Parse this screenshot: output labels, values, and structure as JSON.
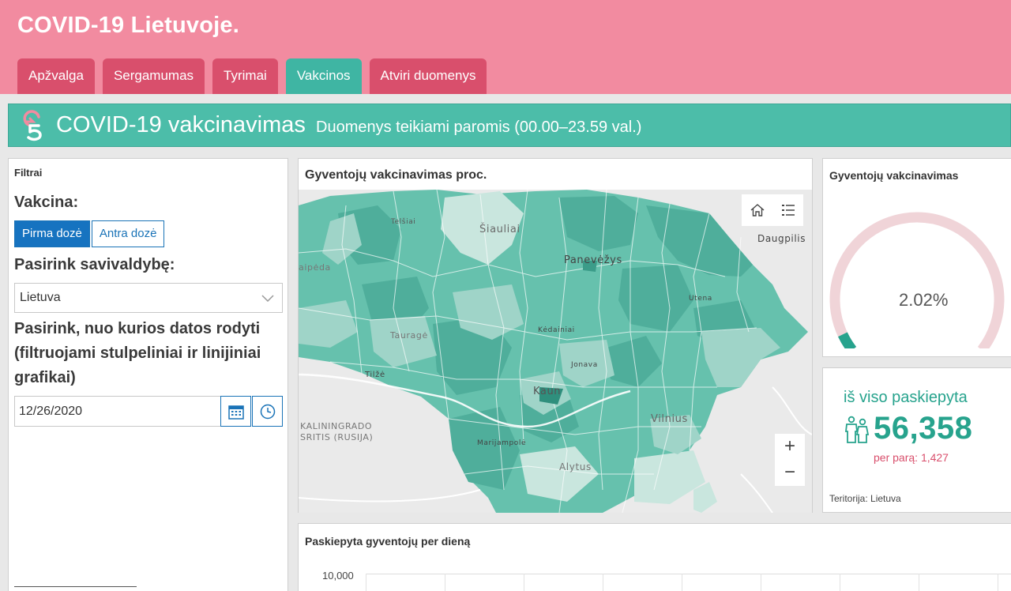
{
  "header": {
    "title": "COVID-19 Lietuvoje.",
    "tabs": [
      {
        "label": "Apžvalga"
      },
      {
        "label": "Sergamumas"
      },
      {
        "label": "Tyrimai"
      },
      {
        "label": "Vakcinos",
        "active": true
      },
      {
        "label": "Atviri duomenys"
      }
    ]
  },
  "banner": {
    "title": "COVID-19 vakcinavimas",
    "subtitle": "Duomenys teikiami paromis (00.00–23.59 val.)",
    "logo_icon": "covid-logo-icon"
  },
  "filters": {
    "panel_title": "Filtrai",
    "vaccine_heading": "Vakcina:",
    "dose_buttons": [
      {
        "label": "Pirma dozė",
        "selected": true
      },
      {
        "label": "Antra dozė",
        "selected": false
      }
    ],
    "municipality_heading": "Pasirink savivaldybę:",
    "municipality_value": "Lietuva",
    "date_heading": "Pasirink, nuo kurios datos rodyti (filtruojami stulpeliniai ir linijiniai grafikai)",
    "date_value": "12/26/2020",
    "calendar_icon": "calendar-icon",
    "clock_icon": "clock-icon"
  },
  "map": {
    "title": "Gyventojų vakcinavimas proc.",
    "labels": {
      "siauliai": "Šiauliai",
      "telsiai": "Telšiai",
      "klaipeda": "aipėda",
      "panevezys": "Panevėžys",
      "utena": "Utena",
      "daugpilis": "Daugpilis",
      "taurage": "Tauragė",
      "kedainiai": "Kėdainiai",
      "jonava": "Jonava",
      "tilze": "Tilžė",
      "kaunas": "Kaun",
      "vilnius": "Vilnius",
      "kaliningrad": "KALININGRADO",
      "sritis": "SRITIS (RUSIJA)",
      "marijampole": "Marijampolė",
      "alytus": "Alytus"
    },
    "tools": [
      "home-icon",
      "legend-list-icon"
    ],
    "zoom_in": "+",
    "zoom_out": "−",
    "colors": {
      "dark": "#4fae9b",
      "mid": "#66c1ad",
      "light": "#9fd4c8",
      "pale": "#c9e6de"
    }
  },
  "gauge": {
    "title": "Gyventojų vakcinavimas",
    "value_label": "2.02%",
    "value_percent": 2.02,
    "track_color": "#f0d4d8",
    "fill_color": "#27a38d"
  },
  "kpi": {
    "label": "iš viso paskiepyta",
    "value": "56,358",
    "daily_label": "per parą:",
    "daily_value": "1,427",
    "territory_label": "Teritorija:",
    "territory_value": "Lietuva",
    "icon": "people-icon"
  },
  "daily_chart": {
    "title": "Paskiepyta gyventojų per dieną",
    "y_tick": "10,000"
  }
}
